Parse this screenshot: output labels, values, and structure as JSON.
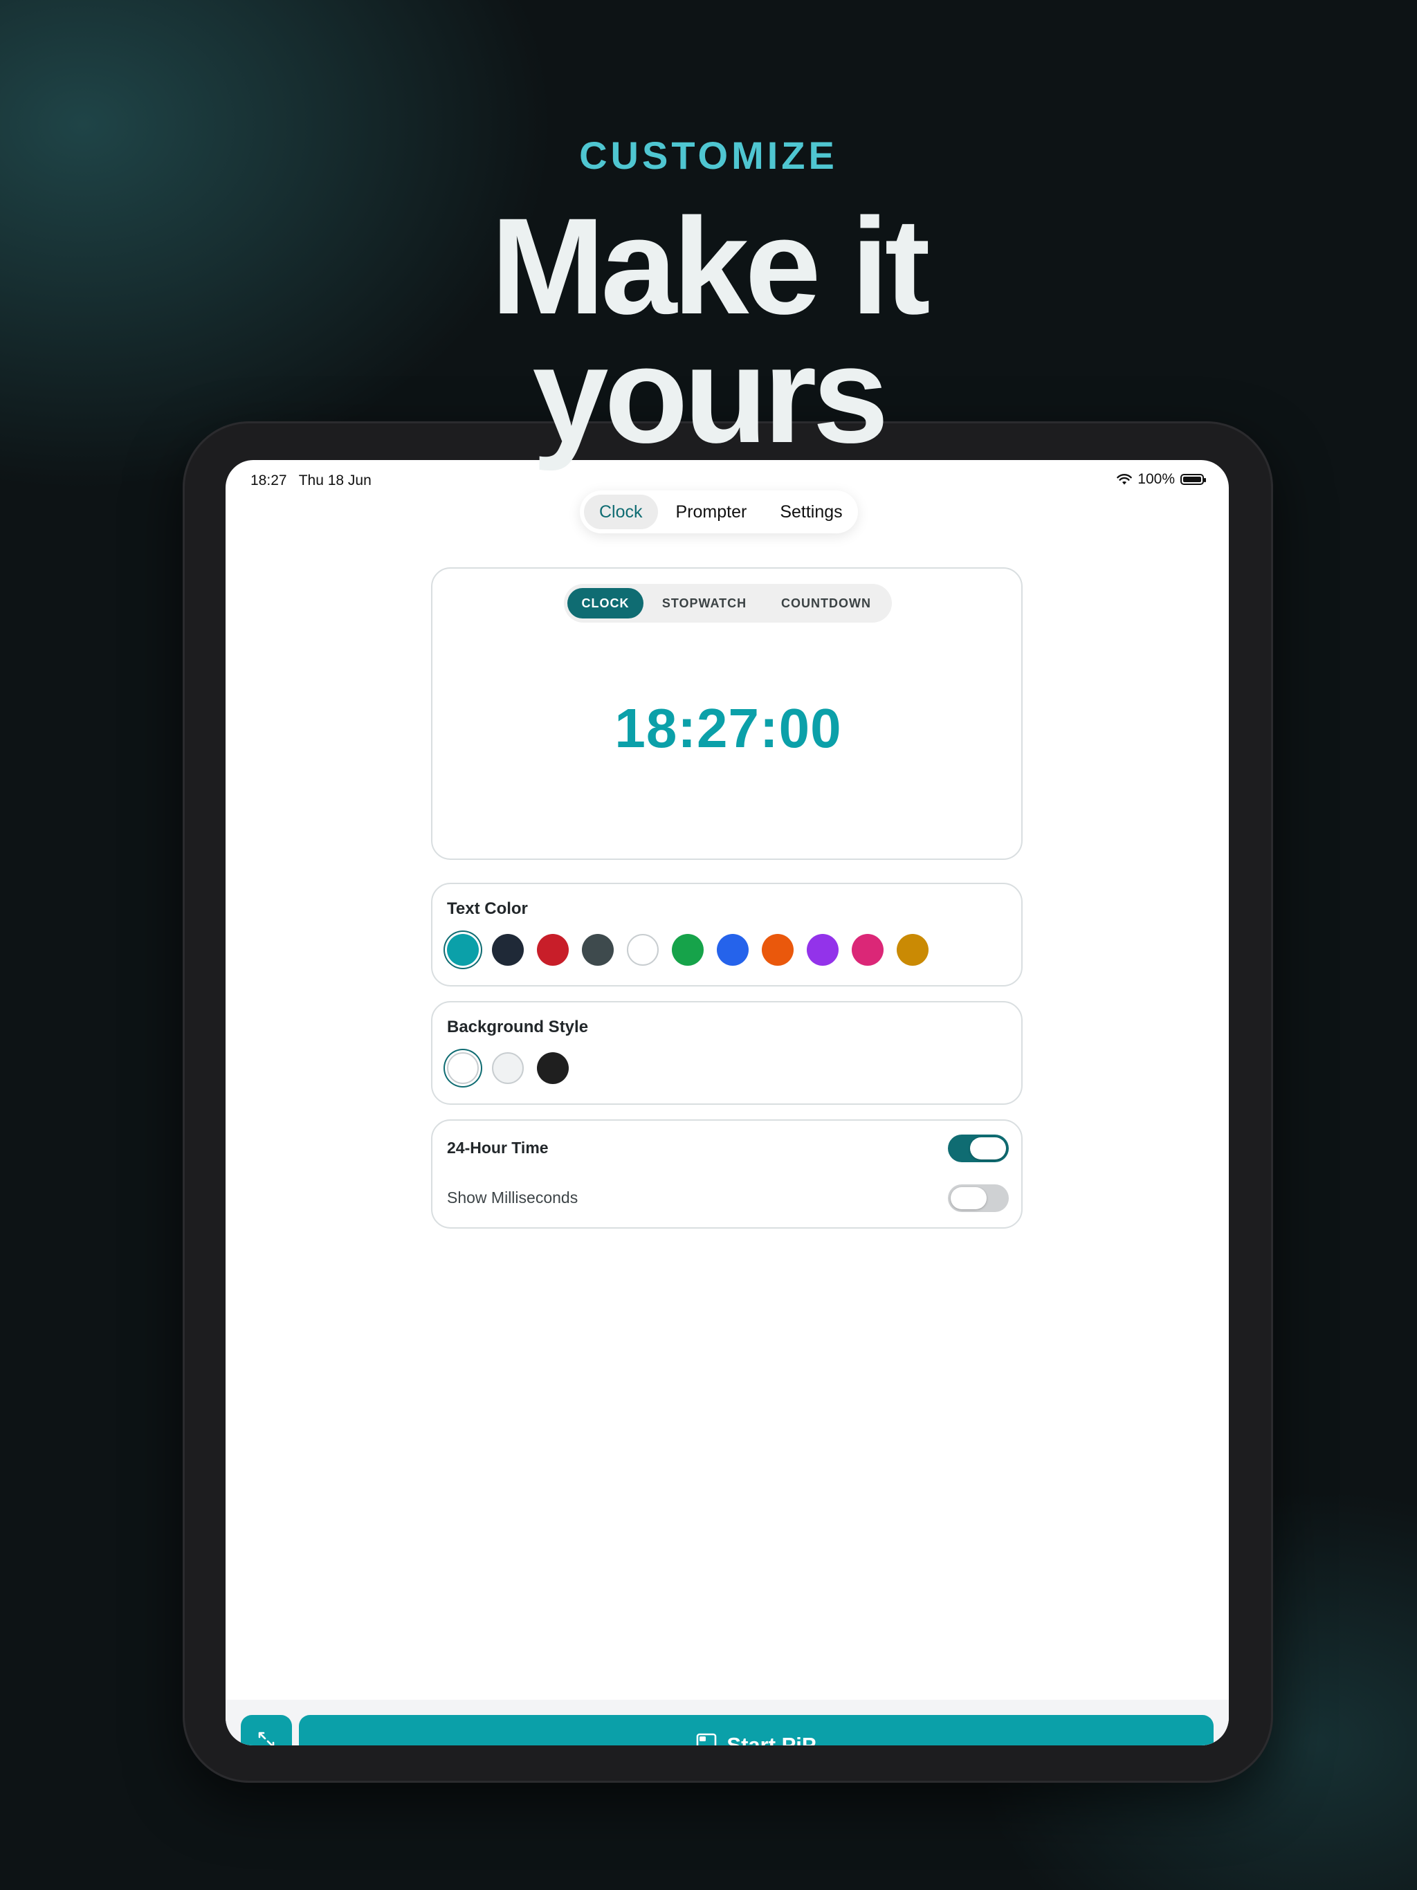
{
  "promo": {
    "kicker": "CUSTOMIZE",
    "headline_line1": "Make it",
    "headline_line2": "yours"
  },
  "status_bar": {
    "time": "18:27",
    "date": "Thu 18 Jun",
    "battery": "100%"
  },
  "top_nav": {
    "tabs": [
      {
        "label": "Clock",
        "active": true
      },
      {
        "label": "Prompter",
        "active": false
      },
      {
        "label": "Settings",
        "active": false
      }
    ]
  },
  "mode_selector": {
    "options": [
      "CLOCK",
      "STOPWATCH",
      "COUNTDOWN"
    ],
    "selected": "CLOCK"
  },
  "clock_display": "18:27:00",
  "text_color": {
    "label": "Text Color",
    "swatches": [
      "#0ba0a9",
      "#1f2937",
      "#c81e29",
      "#3e4a4d",
      "#ffffff",
      "#16a34a",
      "#2563eb",
      "#ea580c",
      "#9333ea",
      "#db2777",
      "#ca8a04"
    ],
    "selected_index": 0
  },
  "background_style": {
    "label": "Background Style",
    "swatches": [
      "#ffffff",
      "#f0f2f3",
      "#1f1f1f"
    ],
    "selected_index": 0
  },
  "toggles": {
    "hour24": {
      "label": "24-Hour Time",
      "on": true
    },
    "milliseconds": {
      "label": "Show Milliseconds",
      "on": false
    }
  },
  "bottom": {
    "start_label": "Start PiP"
  },
  "colors": {
    "accent": "#0ba0a9",
    "dark_accent": "#0f6c72",
    "kicker": "#4fc6d1"
  }
}
